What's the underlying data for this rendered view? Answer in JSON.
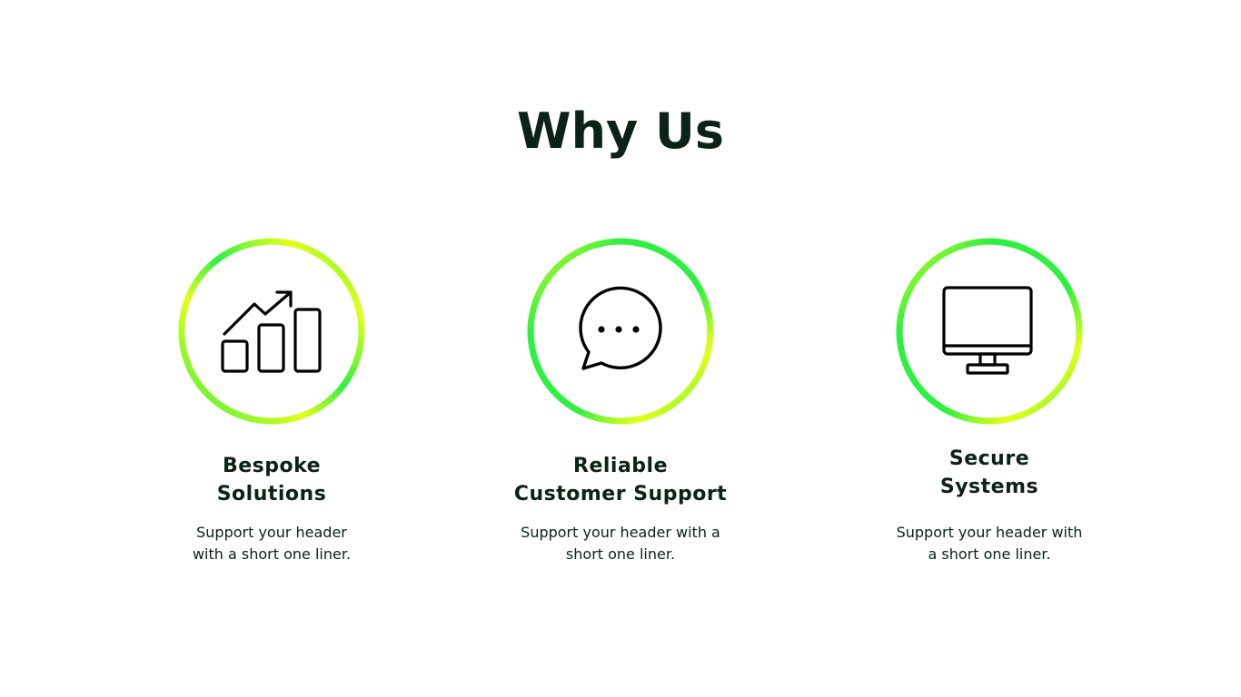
{
  "title": "Why Us",
  "colors": {
    "text": "#0b2216",
    "ring_green": "#2ef040",
    "ring_yellow": "#e6ff1a"
  },
  "features": [
    {
      "icon": "bar-chart-growth-icon",
      "title_lines": [
        "Bespoke",
        "Solutions"
      ],
      "desc_lines": [
        "Support your header",
        "with a short one liner."
      ]
    },
    {
      "icon": "chat-bubble-icon",
      "title_lines": [
        "Reliable",
        "Customer Support"
      ],
      "desc_lines": [
        "Support your header with a",
        "short one liner."
      ]
    },
    {
      "icon": "monitor-icon",
      "title_lines": [
        "Secure",
        "Systems"
      ],
      "desc_lines": [
        "Support your header with",
        "a short one liner."
      ]
    }
  ]
}
